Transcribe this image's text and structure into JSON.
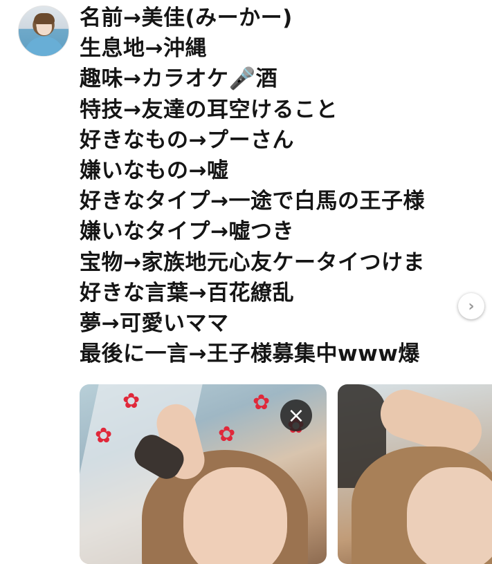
{
  "profile": {
    "avatar_icon": "user-avatar"
  },
  "caption": {
    "lines": [
      "名前→美佳(みーかー)",
      "生息地→沖縄",
      "趣味→カラオケ🎤酒",
      "特技→友達の耳空けること",
      "好きなもの→プーさん",
      "嫌いなもの→嘘",
      "好きなタイプ→一途で白馬の王子様",
      "嫌いなタイプ→嘘つき",
      "宝物→家族地元心友ケータイつけま",
      "好きな言葉→百花繚乱",
      "夢→可愛いママ",
      "最後に一言→王子様募集中www爆"
    ]
  },
  "carousel": {
    "next_icon": "›",
    "close_icon": "×",
    "flower_icon": "✿"
  }
}
